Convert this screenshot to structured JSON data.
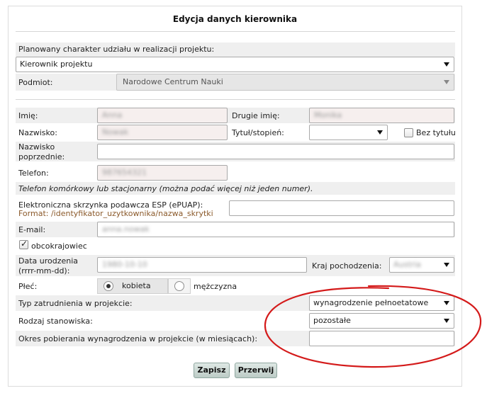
{
  "title": "Edycja danych kierownika",
  "participation": {
    "label": "Planowany charakter udziału w realizacji projektu:",
    "value": "Kierownik projektu"
  },
  "entity": {
    "label": "Podmiot:",
    "value": "Narodowe Centrum Nauki"
  },
  "person": {
    "first_name_label": "Imię:",
    "first_name_value": "Anna",
    "middle_name_label": "Drugie imię:",
    "middle_name_value": "Monika",
    "last_name_label": "Nazwisko:",
    "last_name_value": "Nowak",
    "degree_label": "Tytuł/stopień:",
    "degree_value": "",
    "no_title_label": "Bez tytułu",
    "previous_name_label": "Nazwisko poprzednie:",
    "previous_name_value": "",
    "phone_label": "Telefon:",
    "phone_value": "987654321",
    "phone_note": "Telefon komórkowy lub stacjonarny (można podać więcej niż jeden numer).",
    "epuap_label": "Elektroniczna skrzynka podawcza ESP (ePUAP):",
    "epuap_format": "Format: /identyfikator_uzytkownika/nazwa_skrytki",
    "epuap_value": "",
    "email_label": "E-mail:",
    "email_value": "anna.nowak",
    "foreigner_label": "obcokrajowiec",
    "birth_label": "Data urodzenia (rrrr-mm-dd):",
    "birth_value": "1980-10-10",
    "country_label": "Kraj pochodzenia:",
    "country_value": "Austria",
    "sex_label": "Płeć:",
    "sex_female": "kobieta",
    "sex_male": "mężczyzna"
  },
  "employment": {
    "type_label": "Typ zatrudnienia w projekcie:",
    "type_value": "wynagrodzenie pełnoetatowe",
    "position_label": "Rodzaj stanowiska:",
    "position_value": "pozostałe",
    "period_label": "Okres pobierania wynagrodzenia w projekcie (w miesiącach):",
    "period_value": ""
  },
  "buttons": {
    "save": "Zapisz",
    "cancel": "Przerwij"
  },
  "colors": {
    "annotation": "#d41a1a",
    "row_bg": "#efefef",
    "button": "#c9d8d3"
  }
}
